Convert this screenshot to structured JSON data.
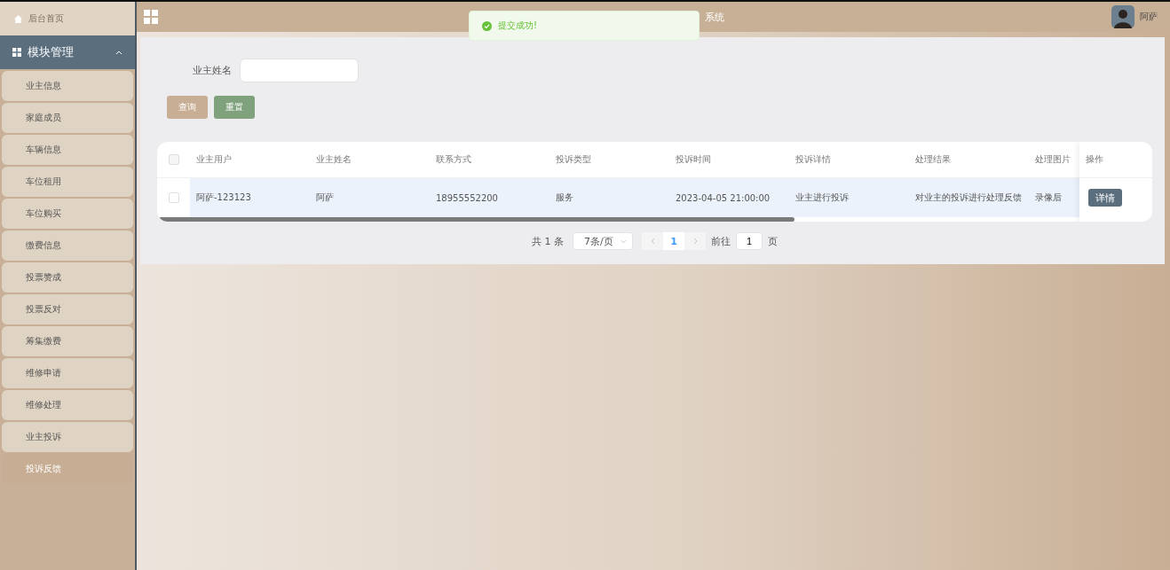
{
  "sidebar": {
    "home": {
      "label": "后台首页"
    },
    "group": {
      "label": "模块管理",
      "expanded": true
    },
    "items": [
      {
        "label": "业主信息",
        "selected": false
      },
      {
        "label": "家庭成员",
        "selected": false
      },
      {
        "label": "车辆信息",
        "selected": false
      },
      {
        "label": "车位租用",
        "selected": false
      },
      {
        "label": "车位购买",
        "selected": false
      },
      {
        "label": "缴费信息",
        "selected": false
      },
      {
        "label": "投票赞成",
        "selected": false
      },
      {
        "label": "投票反对",
        "selected": false
      },
      {
        "label": "筹集缴费",
        "selected": false
      },
      {
        "label": "维修申请",
        "selected": false
      },
      {
        "label": "维修处理",
        "selected": false
      },
      {
        "label": "业主投诉",
        "selected": false
      },
      {
        "label": "投诉反馈",
        "selected": true
      }
    ]
  },
  "header": {
    "title": "系统",
    "user": "阿萨"
  },
  "toast": {
    "message": "提交成功!"
  },
  "search": {
    "label": "业主姓名",
    "buttons": [
      "查询",
      "重置"
    ]
  },
  "table": {
    "columns": [
      "业主用户",
      "业主姓名",
      "联系方式",
      "投诉类型",
      "投诉时间",
      "投诉详情",
      "处理结果",
      "处理图片"
    ],
    "action_column": "操作",
    "all_checked": false,
    "rows": [
      {
        "checked": false,
        "cells": [
          "阿萨-123123",
          "阿萨",
          "18955552200",
          "服务",
          "2023-04-05 21:00:00",
          "业主进行投诉",
          "对业主的投诉进行处理反馈",
          "录像后"
        ],
        "action": "详情"
      }
    ]
  },
  "pagination": {
    "total": "共 1 条",
    "page_size": "7条/页",
    "pages": [
      {
        "label": "1",
        "selected": true
      }
    ],
    "goto_label": "前往",
    "goto_value": "1",
    "goto_suffix": "页"
  }
}
